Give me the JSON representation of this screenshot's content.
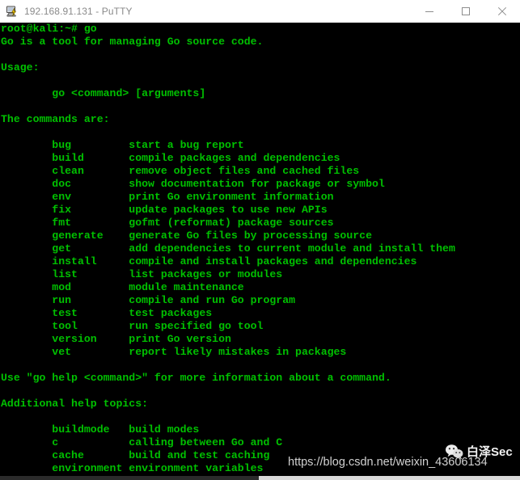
{
  "window": {
    "title": "192.168.91.131 - PuTTY",
    "icon": "putty-computer-icon",
    "controls": {
      "minimize": "Minimize",
      "maximize": "Maximize",
      "close": "Close"
    }
  },
  "terminal": {
    "colors": {
      "background": "#000000",
      "foreground": "#00c000"
    },
    "prompt": "root@kali:~# ",
    "command": "go",
    "lines": [
      "root@kali:~# go",
      "Go is a tool for managing Go source code.",
      "",
      "Usage:",
      "",
      "        go <command> [arguments]",
      "",
      "The commands are:",
      "",
      "        bug         start a bug report",
      "        build       compile packages and dependencies",
      "        clean       remove object files and cached files",
      "        doc         show documentation for package or symbol",
      "        env         print Go environment information",
      "        fix         update packages to use new APIs",
      "        fmt         gofmt (reformat) package sources",
      "        generate    generate Go files by processing source",
      "        get         add dependencies to current module and install them",
      "        install     compile and install packages and dependencies",
      "        list        list packages or modules",
      "        mod         module maintenance",
      "        run         compile and run Go program",
      "        test        test packages",
      "        tool        run specified go tool",
      "        version     print Go version",
      "        vet         report likely mistakes in packages",
      "",
      "Use \"go help <command>\" for more information about a command.",
      "",
      "Additional help topics:",
      "",
      "        buildmode   build modes",
      "        c           calling between Go and C",
      "        cache       build and test caching",
      "        environment environment variables"
    ],
    "commands": [
      {
        "name": "bug",
        "description": "start a bug report"
      },
      {
        "name": "build",
        "description": "compile packages and dependencies"
      },
      {
        "name": "clean",
        "description": "remove object files and cached files"
      },
      {
        "name": "doc",
        "description": "show documentation for package or symbol"
      },
      {
        "name": "env",
        "description": "print Go environment information"
      },
      {
        "name": "fix",
        "description": "update packages to use new APIs"
      },
      {
        "name": "fmt",
        "description": "gofmt (reformat) package sources"
      },
      {
        "name": "generate",
        "description": "generate Go files by processing source"
      },
      {
        "name": "get",
        "description": "add dependencies to current module and install them"
      },
      {
        "name": "install",
        "description": "compile and install packages and dependencies"
      },
      {
        "name": "list",
        "description": "list packages or modules"
      },
      {
        "name": "mod",
        "description": "module maintenance"
      },
      {
        "name": "run",
        "description": "compile and run Go program"
      },
      {
        "name": "test",
        "description": "test packages"
      },
      {
        "name": "tool",
        "description": "run specified go tool"
      },
      {
        "name": "version",
        "description": "print Go version"
      },
      {
        "name": "vet",
        "description": "report likely mistakes in packages"
      }
    ],
    "help_topics": [
      {
        "name": "buildmode",
        "description": "build modes"
      },
      {
        "name": "c",
        "description": "calling between Go and C"
      },
      {
        "name": "cache",
        "description": "build and test caching"
      },
      {
        "name": "environment",
        "description": "environment variables"
      }
    ],
    "headings": {
      "intro": "Go is a tool for managing Go source code.",
      "usage": "Usage:",
      "usage_line": "go <command> [arguments]",
      "commands_are": "The commands are:",
      "help_hint": "Use \"go help <command>\" for more information about a command.",
      "additional": "Additional help topics:"
    }
  },
  "watermark": {
    "url": "https://blog.csdn.net/weixin_43606134",
    "brand": "白泽Sec",
    "logo": "wechat-icon"
  }
}
